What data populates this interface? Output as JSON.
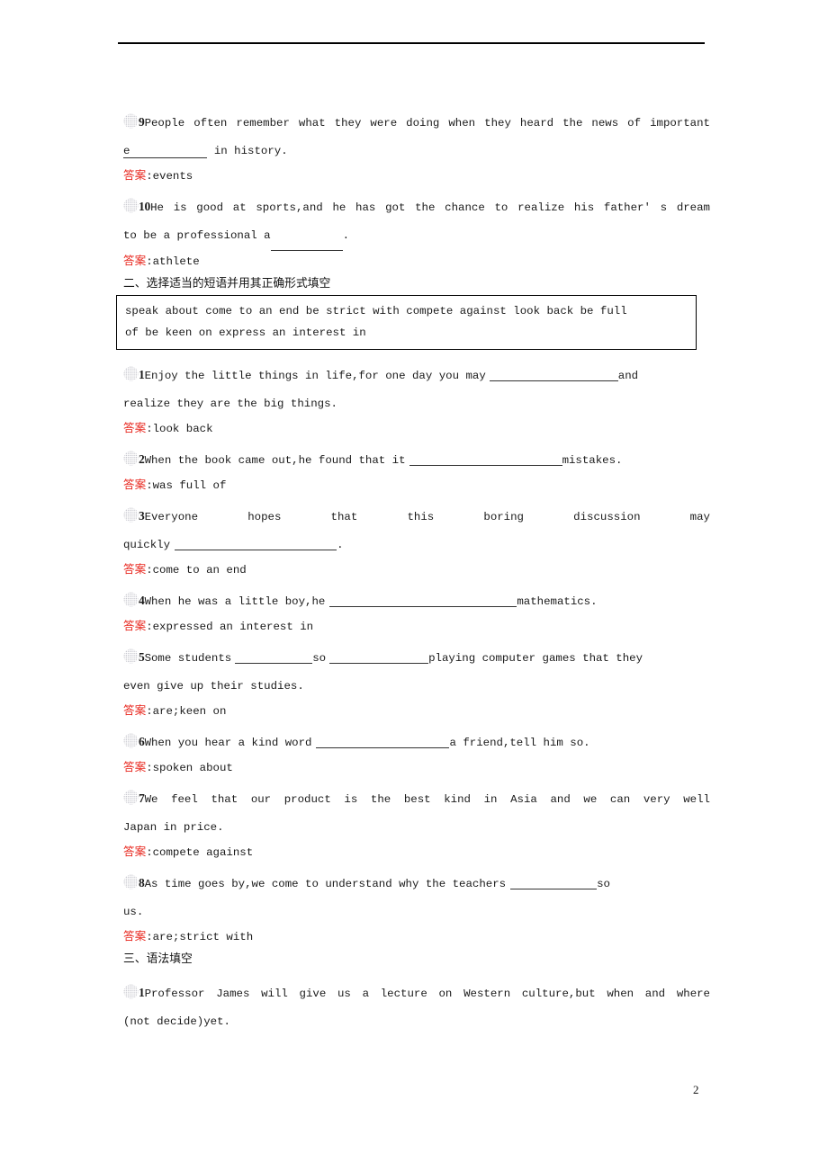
{
  "page": {
    "number": "2",
    "header_rule": true
  },
  "items": [
    {
      "id": "q9",
      "num": "9",
      "text_before": "People often remember what they were doing when they heard the news of important",
      "line2_prefix": "e",
      "line2_suffix": " in history.",
      "answer_label": "答案",
      "answer": ":events"
    },
    {
      "id": "q10",
      "num": "10",
      "text_before": "He is good at sports,and he has got the chance to realize his father' s dream",
      "line2_prefix": "to be a professional a",
      "line2_suffix": ".",
      "answer_label": "答案",
      "answer": ":athlete"
    }
  ],
  "section2": {
    "heading": "二、选择适当的短语并用其正确形式填空",
    "phrase_box": {
      "line1": "speak about  come to an end  be strict with  compete against  look back  be full",
      "line2": "of  be keen on  express an interest in"
    },
    "questions": [
      {
        "id": "s2q1",
        "num": "1",
        "line1_text": "Enjoy the little things in life,for one day you may",
        "line1_tail": "and",
        "line2": "realize they are the big things.",
        "answer_label": "答案",
        "answer": ":look back"
      },
      {
        "id": "s2q2",
        "num": "2",
        "line1_text": "When the book came out,he found that it",
        "line1_tail": "mistakes.",
        "answer_label": "答案",
        "answer": ":was full of"
      },
      {
        "id": "s2q3",
        "num": "3",
        "line1_text": "Everyone hopes that this boring discussion may",
        "line2_prefix": "quickly",
        "line2_suffix": ".",
        "answer_label": "答案",
        "answer": ":come to an end"
      },
      {
        "id": "s2q4",
        "num": "4",
        "line1_text": "When he was a little boy,he",
        "line1_tail": "mathematics.",
        "answer_label": "答案",
        "answer": ":expressed an interest in"
      },
      {
        "id": "s2q5",
        "num": "5",
        "line1_a": "Some students",
        "line1_b": "so",
        "line1_c": "playing computer games that they",
        "line2": "even give up their studies.",
        "answer_label": "答案",
        "answer": ":are;keen on"
      },
      {
        "id": "s2q6",
        "num": "6",
        "line1_text": "When you hear a kind word",
        "line1_tail": "a friend,tell him so.",
        "answer_label": "答案",
        "answer": ":spoken about"
      },
      {
        "id": "s2q7",
        "num": "7",
        "line1_text": "We feel that our product is the best kind in Asia and we can very well",
        "line2": "Japan in price.",
        "answer_label": "答案",
        "answer": ":compete against"
      },
      {
        "id": "s2q8",
        "num": "8",
        "line1_text": "As time goes by,we come to understand why the teachers",
        "line1_tail": "so",
        "line2": "us.",
        "answer_label": "答案",
        "answer": ":are;strict with"
      }
    ]
  },
  "section3": {
    "heading": "三、语法填空",
    "questions": [
      {
        "id": "s3q1",
        "num": "1",
        "line1_text": "Professor James will give us a lecture on Western culture,but when and where",
        "line2": "(not decide)yet."
      }
    ]
  }
}
